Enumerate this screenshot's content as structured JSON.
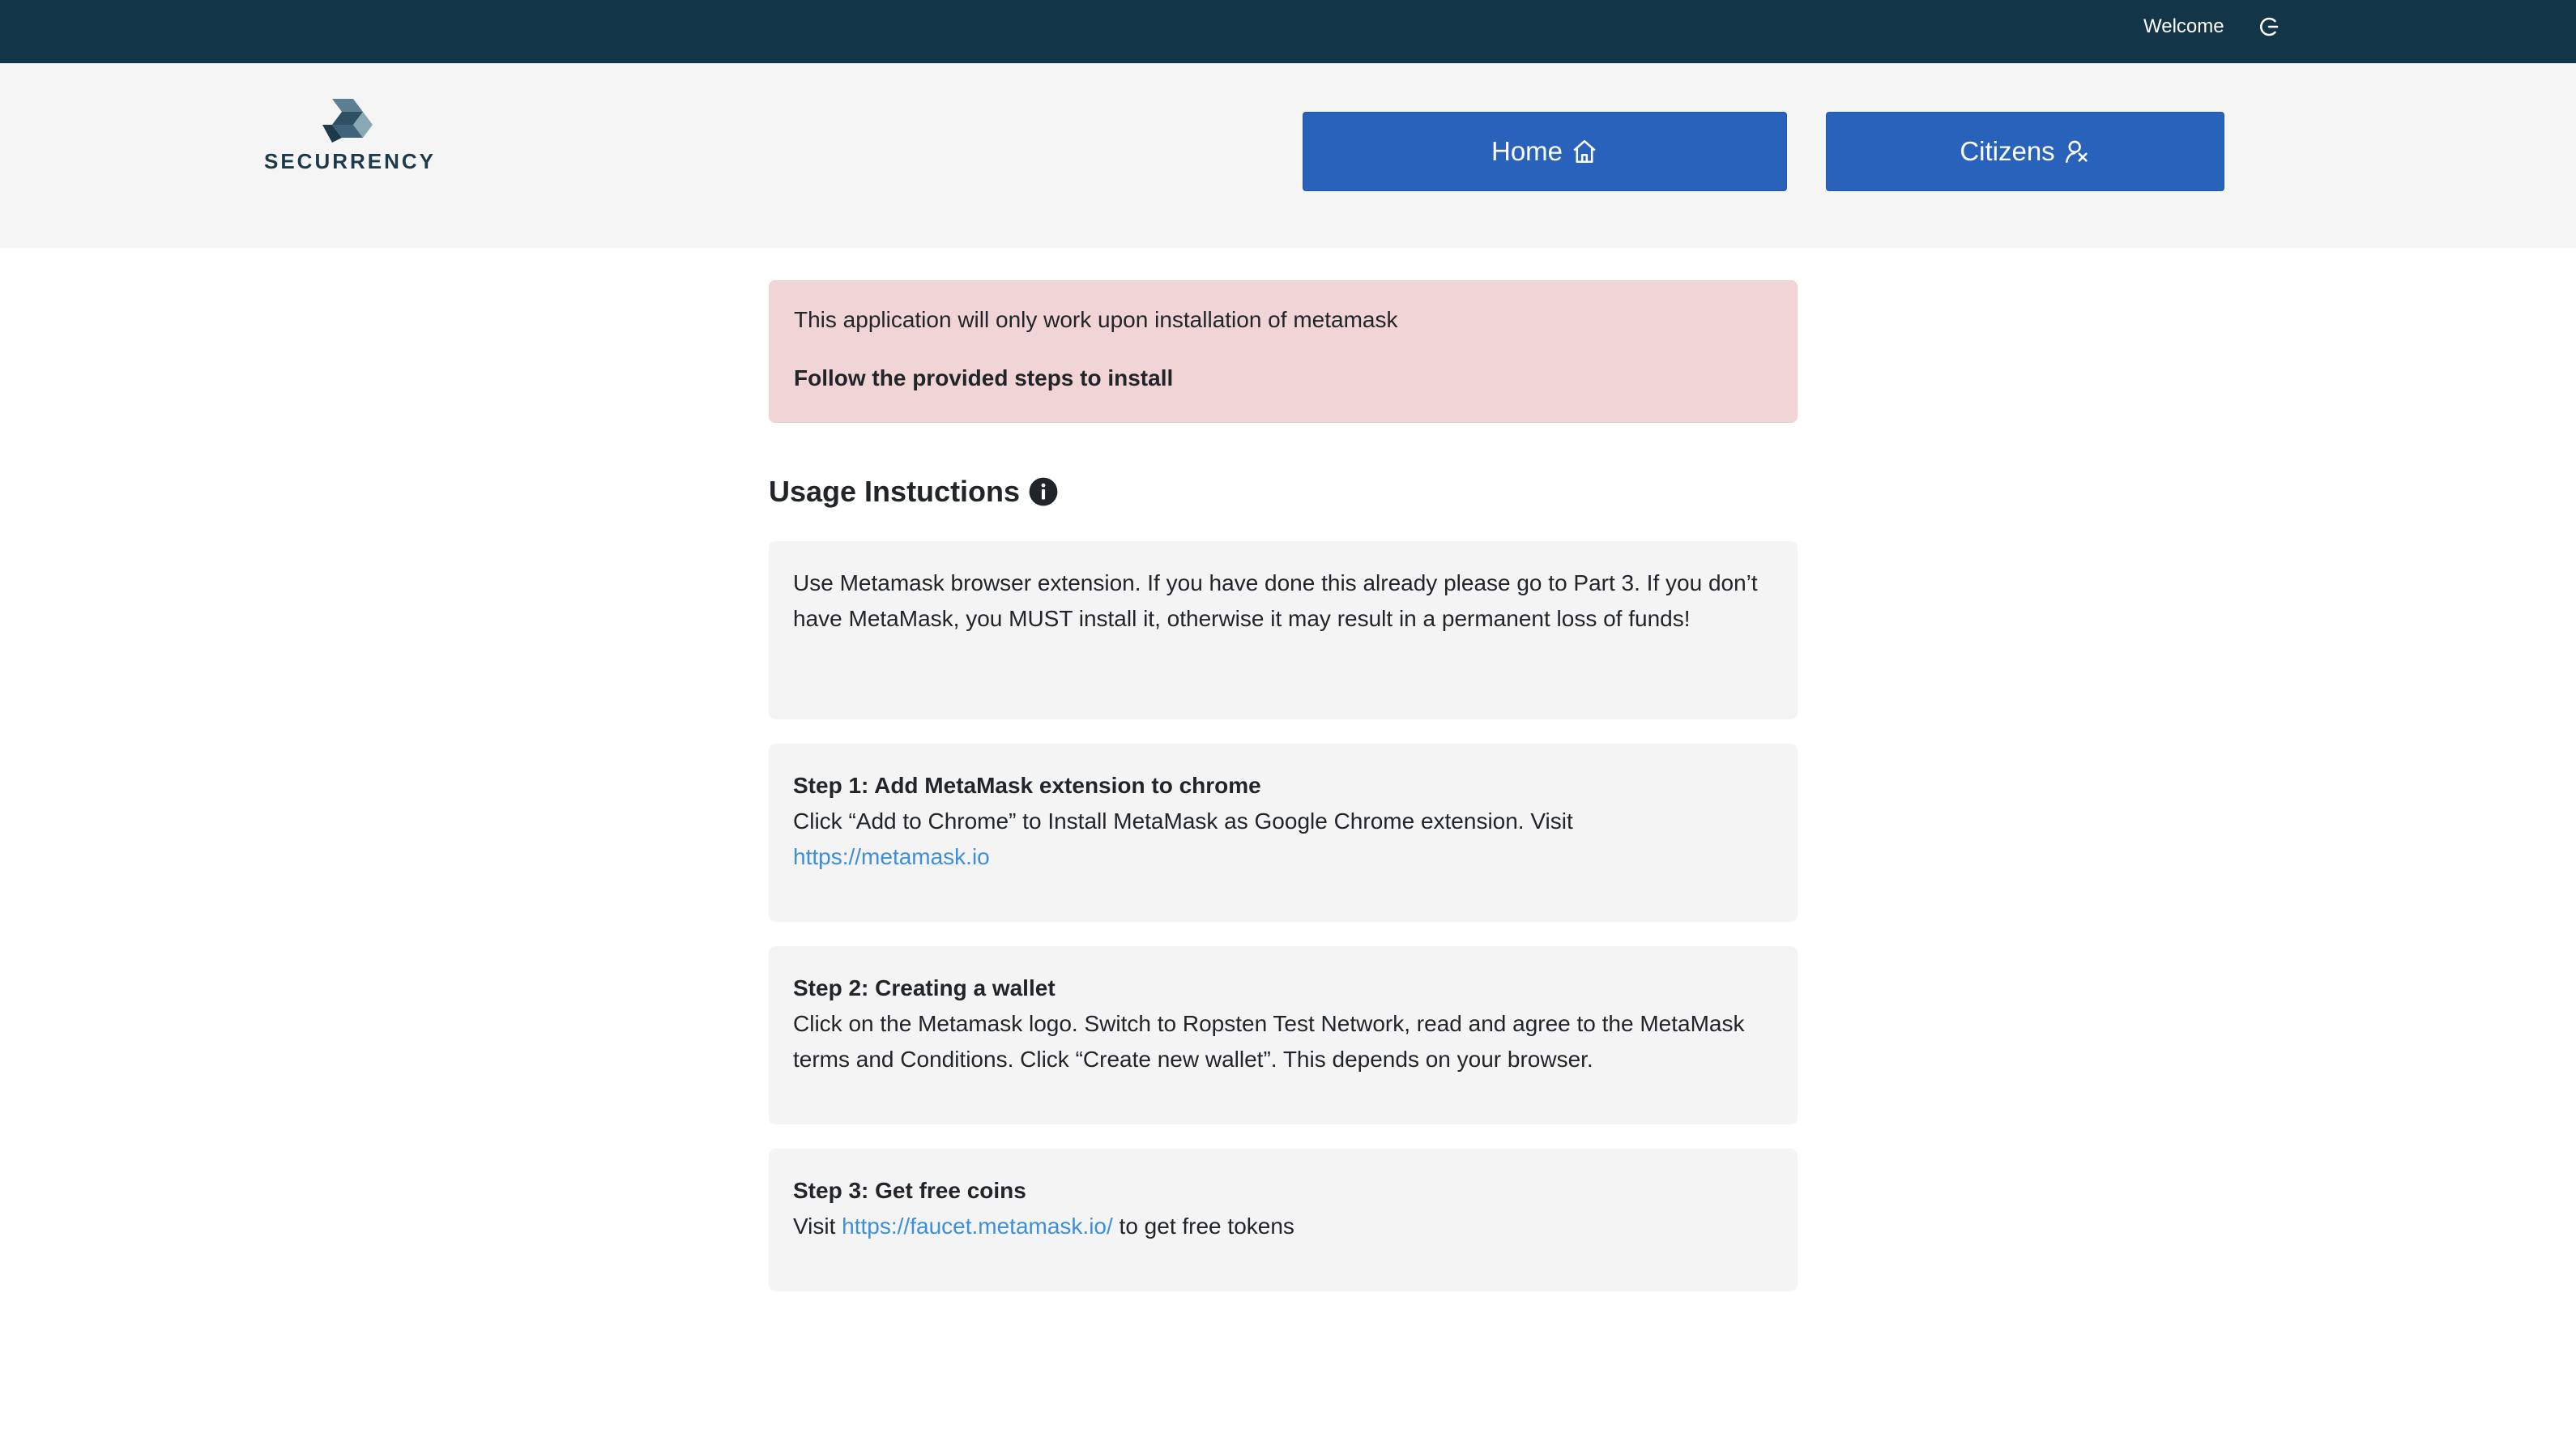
{
  "topbar": {
    "welcome": "Welcome",
    "logout_icon": "logout-icon"
  },
  "logo": {
    "text": "SECURRENCY"
  },
  "nav": {
    "home_label": "Home",
    "home_icon": "home-icon",
    "citizens_label": "Citizens",
    "citizens_icon": "citizens-icon"
  },
  "alert": {
    "line1": "This application will only work upon installation of metamask",
    "line2": "Follow the provided steps to install"
  },
  "usage": {
    "title": "Usage Instuctions",
    "info_icon": "info-icon",
    "intro": "Use Metamask browser extension. If you have done this already please go to Part 3. If you don’t have MetaMask, you MUST install it, otherwise it may result in a permanent loss of funds!",
    "step1": {
      "heading": "Step 1: Add MetaMask extension to chrome",
      "text": "Click “Add to Chrome” to Install MetaMask as Google Chrome extension. Visit",
      "link": "https://metamask.io"
    },
    "step2": {
      "heading": "Step 2: Creating a wallet",
      "text": "Click on the Metamask logo. Switch to Ropsten Test Network, read and agree to the MetaMask terms and Conditions. Click “Create new wallet”. This depends on your browser."
    },
    "step3": {
      "heading": "Step 3: Get free coins",
      "text_before": "Visit",
      "link": "https://faucet.metamask.io/",
      "text_after": "to get free tokens"
    }
  },
  "colors": {
    "topbar": "#123548",
    "navbar": "#f5f5f5",
    "button": "#2862bb",
    "alert_bg": "#f1d5d6",
    "card_bg": "#f4f4f4",
    "link": "#3d8fd9"
  }
}
